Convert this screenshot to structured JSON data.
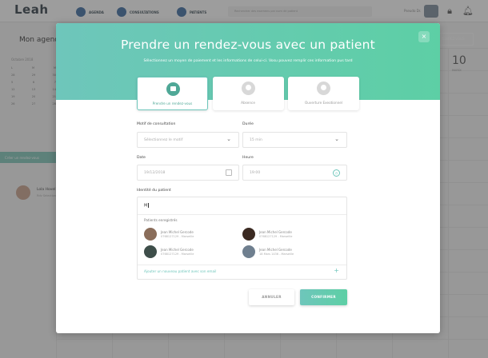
{
  "app": {
    "logo": "Leah",
    "nav": [
      {
        "label": "AGENDA",
        "icon": "calendar-icon"
      },
      {
        "label": "CONSULTATIONS",
        "icon": "stethoscope-icon"
      },
      {
        "label": "PATIENTS",
        "icon": "patients-icon"
      }
    ],
    "search_placeholder": "Rechercher des examens par nom de patient",
    "user_label": "Pseudo Dr.",
    "page_title": "Mon agenda",
    "side_button": "RENDEZ-VOUS",
    "day_number": "10",
    "day_name": "MARDI",
    "calendar_month": "Octobre 2018",
    "calendar_rows": [
      [
        "L",
        "M",
        "M"
      ],
      [
        "28",
        "29",
        "30"
      ],
      [
        "5",
        "6",
        "7"
      ],
      [
        "12",
        "13",
        "14"
      ],
      [
        "19",
        "20",
        "21"
      ],
      [
        "26",
        "27",
        "28"
      ]
    ],
    "create_button": "Créer un rendez-vous",
    "contact_name": "Lola Hovel",
    "contact_sub": "Rdv Selection",
    "colors": {
      "accent": "#6ec6bb",
      "accent2": "#5dcfa5",
      "dark": "#2f3b45"
    }
  },
  "modal": {
    "title": "Prendre un rendez-vous avec un patient",
    "subtitle": "Sélectionnez un moyen de paiement et les informations de celui-ci. Vosu pouvez remplir ces information pus tard",
    "close": "×",
    "tabs": [
      {
        "label": "Prendre un rendez-vous",
        "icon": "calendar-icon",
        "active": true
      },
      {
        "label": "Absence",
        "icon": "person-icon",
        "active": false
      },
      {
        "label": "Ouverture Exeotionnel",
        "icon": "person-icon",
        "active": false
      }
    ],
    "motif": {
      "label": "Motif de consultation",
      "placeholder": "Sélectionnez le motif"
    },
    "duree": {
      "label": "Durée",
      "value": "15 min"
    },
    "date": {
      "label": "Date",
      "value": "19/12/2018"
    },
    "heure": {
      "label": "Heure",
      "value": "19:00"
    },
    "patient": {
      "label": "Identité du patient",
      "input_value": "M",
      "suggest_label": "Patients enregistrés",
      "suggestions": [
        {
          "name": "Jean Michel Gercode",
          "sub": "0768127129 - Marseille"
        },
        {
          "name": "Jean Michel Gercode",
          "sub": "0768127129 - Marseille"
        },
        {
          "name": "Jean Michel Gercode",
          "sub": "0768127129 - Marseille"
        },
        {
          "name": "Jean Michel Gercode",
          "sub": "18 Mars 1436 - Marseille"
        }
      ],
      "add_link": "Ajouter un nouveau patient avec son email",
      "add_plus": "+"
    },
    "cancel": "ANNULER",
    "confirm": "CONFIRMER"
  }
}
